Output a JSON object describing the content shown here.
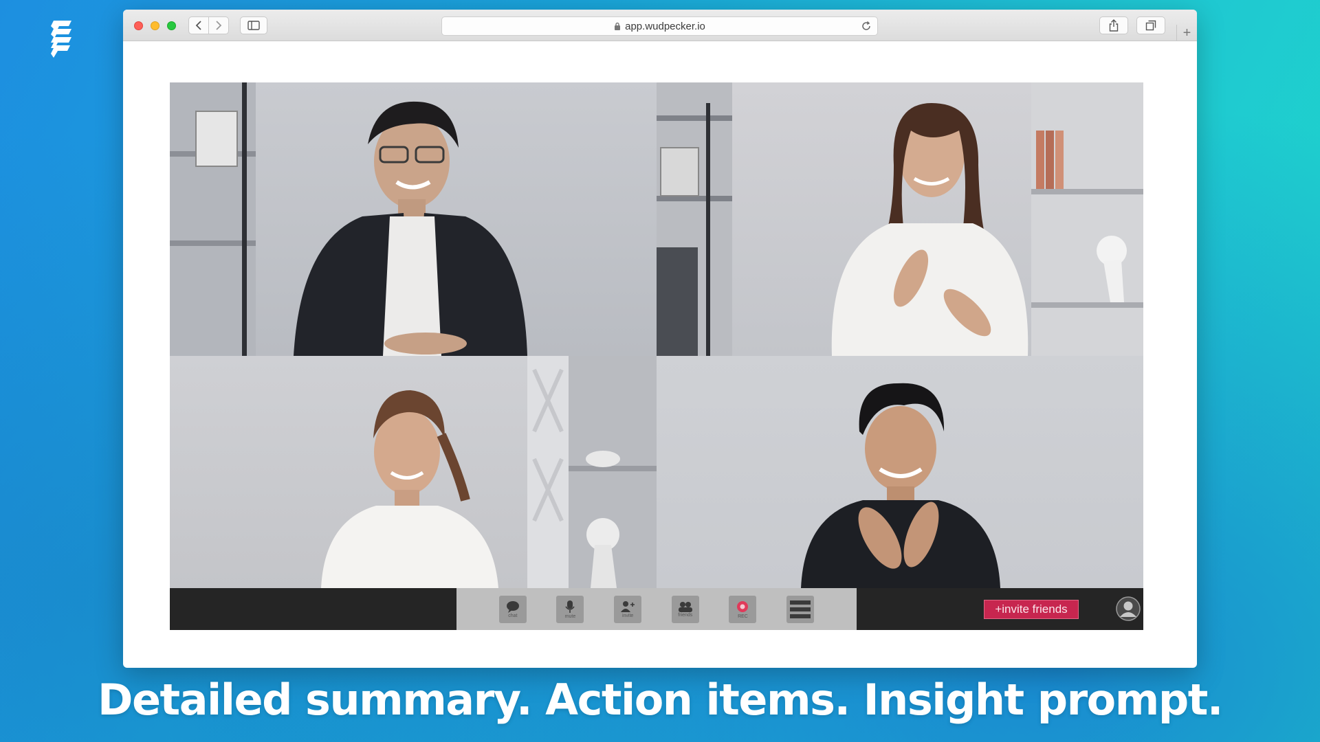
{
  "browser": {
    "url": "app.wudpecker.io",
    "new_tab_symbol": "+"
  },
  "meeting": {
    "participants": [
      {
        "label": "participant-1"
      },
      {
        "label": "participant-2"
      },
      {
        "label": "participant-3"
      },
      {
        "label": "participant-4"
      }
    ],
    "controls": [
      {
        "label": "chat",
        "icon": "chat-icon"
      },
      {
        "label": "mute",
        "icon": "microphone-icon"
      },
      {
        "label": "invite",
        "icon": "add-person-icon"
      },
      {
        "label": "friends",
        "icon": "people-icon"
      },
      {
        "label": "REC",
        "icon": "record-icon"
      },
      {
        "label": "",
        "icon": "menu-icon"
      }
    ],
    "invite_button": "+invite friends"
  },
  "caption": "Detailed summary. Action items. Insight prompt.",
  "colors": {
    "invite_bg": "#c7264f",
    "record": "#e03a5a",
    "bg_left": "#1d8fe0",
    "bg_right": "#1ed9c9"
  }
}
